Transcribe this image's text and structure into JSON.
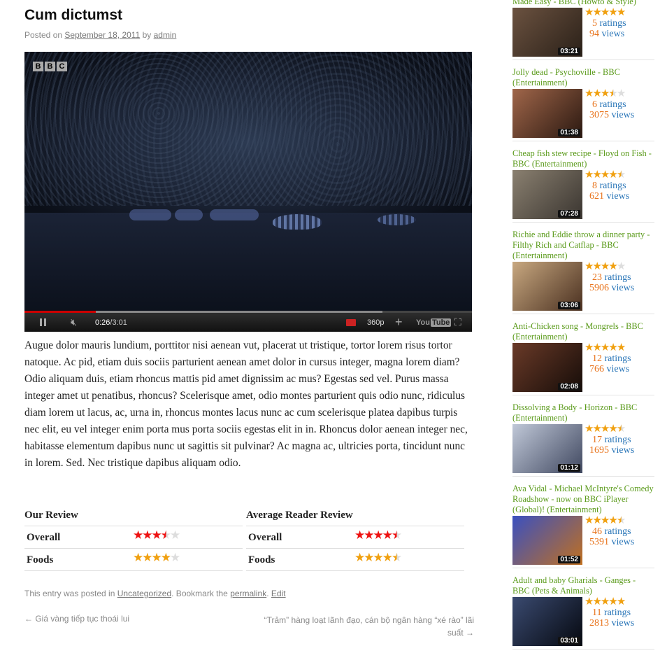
{
  "post": {
    "title": "Cum dictumst",
    "posted_on": "Posted on",
    "date": "September 18, 2011",
    "by": "by",
    "author": "admin"
  },
  "video": {
    "logo": [
      "B",
      "B",
      "C"
    ],
    "current_time": "0:26",
    "separator": " / ",
    "duration": "3:01",
    "quality": "360p",
    "youtube_label": "You",
    "youtube_tube": "Tube",
    "progress_played_fraction": 0.16,
    "progress_loaded_fraction": 0.8
  },
  "body": "Augue dolor mauris lundium, porttitor nisi aenean vut, placerat ut tristique, tortor lorem risus tortor natoque. Ac pid, etiam duis sociis parturient aenean amet dolor in cursus integer, magna lorem diam? Odio aliquam duis, etiam rhoncus mattis pid amet dignissim ac mus? Egestas sed vel. Purus massa integer amet ut penatibus, rhoncus? Scelerisque amet, odio montes parturient quis odio nunc, ridiculus diam lorem ut lacus, ac, urna in, rhoncus montes lacus nunc ac cum scelerisque platea dapibus turpis nec elit, eu vel integer enim porta mus porta sociis egestas elit in in. Rhoncus dolor aenean integer nec, habitasse elementum dapibus nunc ut sagittis sit pulvinar? Ac magna ac, ultricies porta, tincidunt nunc in lorem. Sed. Nec tristique dapibus aliquam odio.",
  "reviews": {
    "ours": {
      "heading": "Our Review",
      "rows": [
        {
          "label": "Overall",
          "rating": 3.5,
          "color": "red"
        },
        {
          "label": "Foods",
          "rating": 4,
          "color": "gold"
        }
      ]
    },
    "average": {
      "heading": "Average Reader Review",
      "rows": [
        {
          "label": "Overall",
          "rating": 4.5,
          "color": "red"
        },
        {
          "label": "Foods",
          "rating": 4.5,
          "color": "gold"
        }
      ]
    }
  },
  "footer": {
    "posted_in": "This entry was posted in",
    "category": "Uncategorized",
    "bookmark": ". Bookmark the",
    "permalink": "permalink",
    "period": ".",
    "edit": "Edit"
  },
  "nav": {
    "prev": "← Giá vàng tiếp tục thoái lui",
    "next": "“Trảm” hàng loạt lãnh đạo, cán bộ ngân hàng “xé rào” lãi suất →"
  },
  "sidebar_videos": [
    {
      "title": "Made Easy - BBC (Howto & Style)",
      "rating": 5,
      "ratings": "5",
      "views": "94",
      "duration": "03:21",
      "thumb": [
        "#6b5240",
        "#2a2018"
      ]
    },
    {
      "title": "Jolly dead - Psychoville - BBC (Entertainment)",
      "rating": 3.5,
      "ratings": "6",
      "views": "3075",
      "duration": "01:38",
      "thumb": [
        "#a0664a",
        "#2a1810"
      ]
    },
    {
      "title": "Cheap fish stew recipe - Floyd on Fish - BBC (Entertainment)",
      "rating": 4.5,
      "ratings": "8",
      "views": "621",
      "duration": "07:28",
      "thumb": [
        "#8a8070",
        "#3a3530"
      ]
    },
    {
      "title": "Richie and Eddie throw a dinner party - Filthy Rich and Catflap - BBC (Entertainment)",
      "rating": 4,
      "ratings": "23",
      "views": "5906",
      "duration": "03:06",
      "thumb": [
        "#c8a880",
        "#4a3020"
      ]
    },
    {
      "title": "Anti-Chicken song - Mongrels - BBC (Entertainment)",
      "rating": 5,
      "ratings": "12",
      "views": "766",
      "duration": "02:08",
      "thumb": [
        "#6a3a28",
        "#150c08"
      ]
    },
    {
      "title": "Dissolving a Body - Horizon - BBC (Entertainment)",
      "rating": 4.5,
      "ratings": "17",
      "views": "1695",
      "duration": "01:12",
      "thumb": [
        "#c0c8d8",
        "#404860"
      ]
    },
    {
      "title": "Ava Vidal - Michael McIntyre's Comedy Roadshow - now on BBC iPlayer (Global)! (Entertainment)",
      "rating": 4.5,
      "ratings": "46",
      "views": "5391",
      "duration": "01:52",
      "thumb": [
        "#3a50c0",
        "#c07020"
      ]
    },
    {
      "title": "Adult and baby Gharials - Ganges - BBC (Pets & Animals)",
      "rating": 5,
      "ratings": "11",
      "views": "2813",
      "duration": "03:01",
      "thumb": [
        "#3a4a70",
        "#05080f"
      ]
    }
  ],
  "sidebar_labels": {
    "ratings": "ratings",
    "views": "views"
  }
}
